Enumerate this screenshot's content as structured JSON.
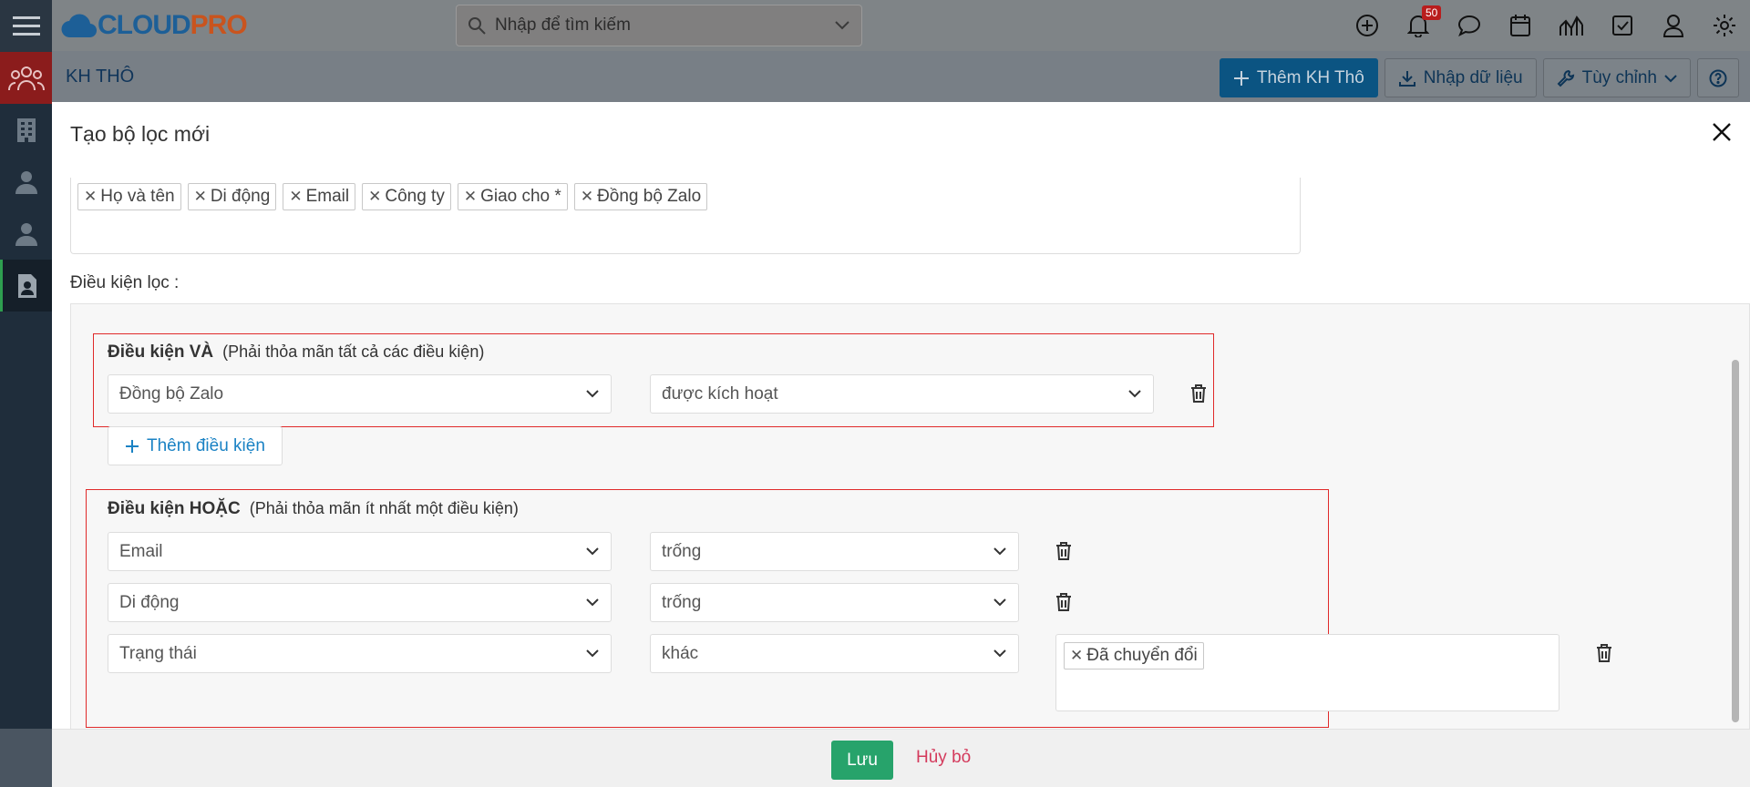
{
  "app": {
    "logo_primary": "CLOUD",
    "logo_accent": "PRO",
    "search_placeholder": "Nhập để tìm kiếm",
    "notification_count": "50",
    "colors": {
      "brand_blue": "#1d5f97",
      "brand_orange": "#c9541e",
      "save_green": "#27a36b",
      "cancel_red": "#d43a5c",
      "highlight_red": "#e02a2a"
    }
  },
  "subheader": {
    "title": "KH THÔ",
    "buttons": {
      "add": "Thêm KH Thô",
      "import": "Nhập dữ liệu",
      "customize": "Tùy chỉnh"
    }
  },
  "modal": {
    "title": "Tạo bộ lọc mới",
    "columns": [
      "Họ và tên",
      "Di động",
      "Email",
      "Công ty",
      "Giao cho *",
      "Đồng bộ Zalo"
    ],
    "conditions_label": "Điều kiện lọc :",
    "and_group": {
      "title": "Điều kiện VÀ",
      "hint": "(Phải thỏa mãn tất cả các điều kiện)",
      "rows": [
        {
          "field": "Đồng bộ Zalo",
          "operator": "được kích hoạt"
        }
      ],
      "add_label": "Thêm điều kiện"
    },
    "or_group": {
      "title": "Điều kiện HOẶC",
      "hint": "(Phải thỏa mãn ít nhất một điều kiện)",
      "rows": [
        {
          "field": "Email",
          "operator": "trống"
        },
        {
          "field": "Di động",
          "operator": "trống"
        },
        {
          "field": "Trạng thái",
          "operator": "khác",
          "values": [
            "Đã chuyển đổi"
          ]
        }
      ]
    }
  },
  "footer": {
    "save": "Lưu",
    "cancel": "Hủy bỏ"
  }
}
